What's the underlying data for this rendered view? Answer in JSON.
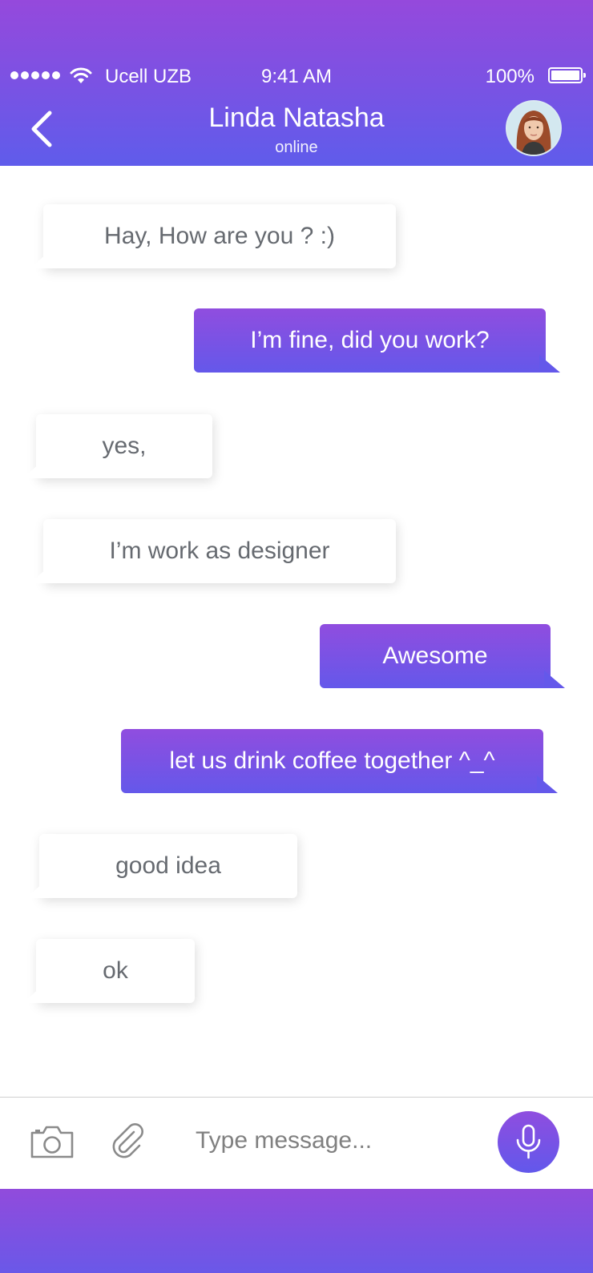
{
  "status_bar": {
    "carrier": "Ucell UZB",
    "time": "9:41 AM",
    "battery": "100%"
  },
  "header": {
    "contact_name": "Linda Natasha",
    "contact_status": "online",
    "back_icon": "chevron-left-icon",
    "avatar_icon": "user-avatar"
  },
  "messages": [
    {
      "direction": "incoming",
      "text": "Hay, How are you ? :)"
    },
    {
      "direction": "outgoing",
      "text": "I’m fine, did you work?"
    },
    {
      "direction": "incoming",
      "text": "yes,"
    },
    {
      "direction": "incoming",
      "text": "I’m work as designer"
    },
    {
      "direction": "outgoing",
      "text": "Awesome"
    },
    {
      "direction": "outgoing",
      "text": "let us drink coffee together ^_^"
    },
    {
      "direction": "incoming",
      "text": "good idea"
    },
    {
      "direction": "incoming",
      "text": "ok"
    }
  ],
  "composer": {
    "placeholder": "Type message...",
    "value": "",
    "camera_icon": "camera-icon",
    "attach_icon": "paperclip-icon",
    "mic_icon": "microphone-icon"
  },
  "colors": {
    "accent_top": "#944ADC",
    "accent_bottom": "#605CEB",
    "incoming_text": "#666A70",
    "outgoing_text": "#FFFFFF"
  }
}
